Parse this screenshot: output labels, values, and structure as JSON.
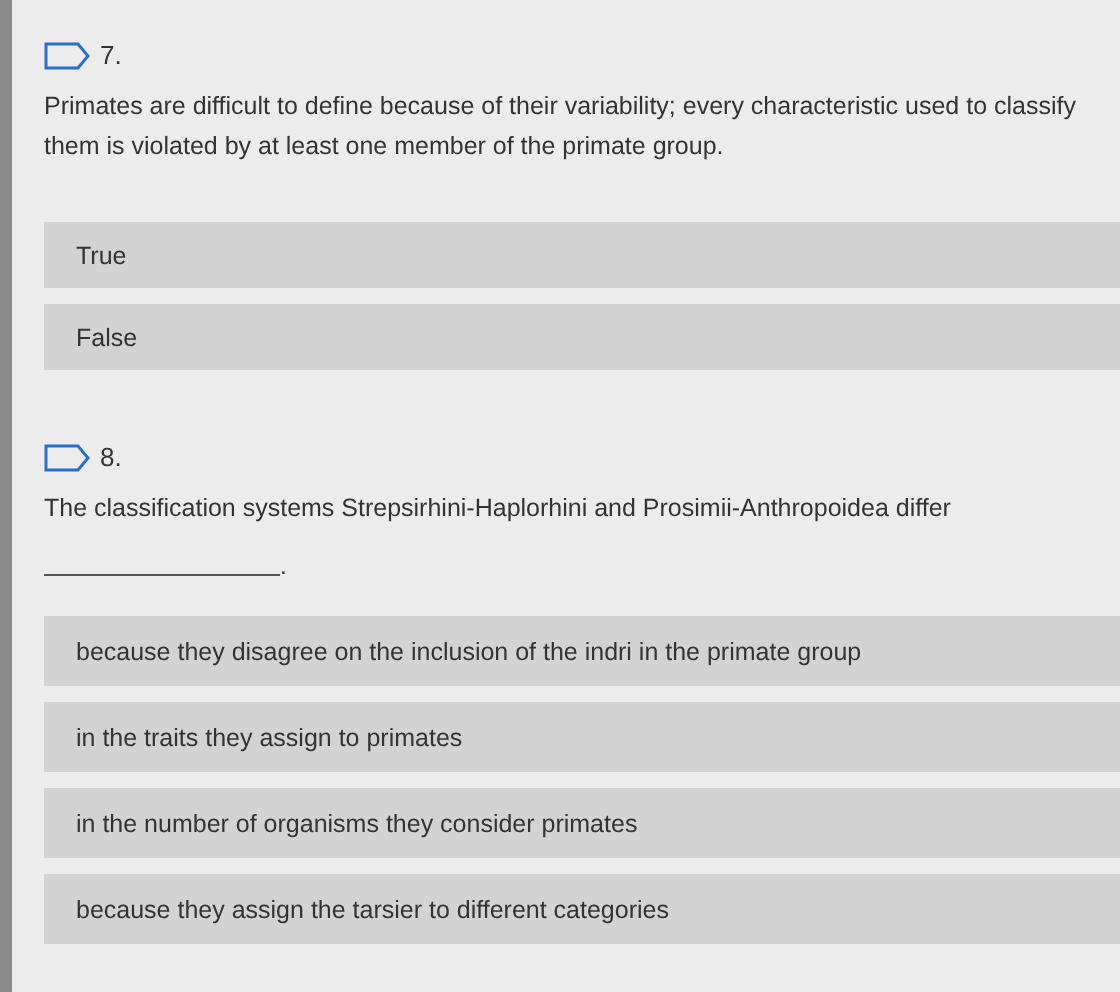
{
  "questions": [
    {
      "number": "7.",
      "text": "Primates are difficult to define because of their variability; every characteristic used to classify them is violated by at least one member of the primate group.",
      "options": [
        {
          "label": "True"
        },
        {
          "label": "False"
        }
      ]
    },
    {
      "number": "8.",
      "text": "The classification systems Strepsirhini-Haplorhini and Prosimii-Anthropoidea differ",
      "blank": {
        "suffix": "."
      },
      "options": [
        {
          "label": "because they disagree on the inclusion of the indri in the primate group"
        },
        {
          "label": "in the traits they assign to primates"
        },
        {
          "label": "in the number of organisms they consider primates"
        },
        {
          "label": "because they assign the tarsier to different categories"
        }
      ]
    }
  ]
}
